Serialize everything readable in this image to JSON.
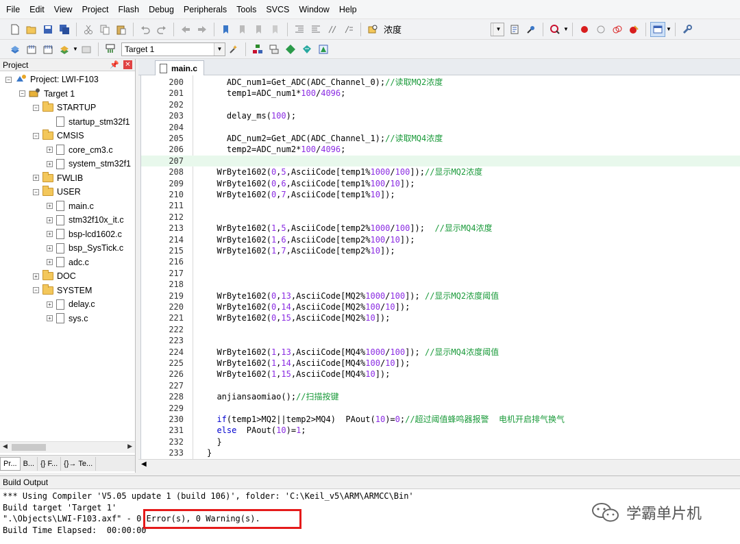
{
  "menu": [
    "File",
    "Edit",
    "View",
    "Project",
    "Flash",
    "Debug",
    "Peripherals",
    "Tools",
    "SVCS",
    "Window",
    "Help"
  ],
  "toolbar": {
    "find_text": "浓度",
    "target_select": "Target 1"
  },
  "project_panel": {
    "title": "Project",
    "pin": "ᵽ",
    "tree": [
      {
        "label": "Project: LWI-F103",
        "level": 0,
        "kind": "project"
      },
      {
        "label": "Target 1",
        "level": 1,
        "kind": "target"
      },
      {
        "label": "STARTUP",
        "level": 2,
        "kind": "folder"
      },
      {
        "label": "startup_stm32f1",
        "level": 3,
        "kind": "file"
      },
      {
        "label": "CMSIS",
        "level": 2,
        "kind": "folder"
      },
      {
        "label": "core_cm3.c",
        "level": 3,
        "kind": "file"
      },
      {
        "label": "system_stm32f1",
        "level": 3,
        "kind": "file"
      },
      {
        "label": "FWLIB",
        "level": 2,
        "kind": "folder"
      },
      {
        "label": "USER",
        "level": 2,
        "kind": "folder"
      },
      {
        "label": "main.c",
        "level": 3,
        "kind": "file"
      },
      {
        "label": "stm32f10x_it.c",
        "level": 3,
        "kind": "file"
      },
      {
        "label": "bsp-lcd1602.c",
        "level": 3,
        "kind": "file"
      },
      {
        "label": "bsp_SysTick.c",
        "level": 3,
        "kind": "file"
      },
      {
        "label": "adc.c",
        "level": 3,
        "kind": "file"
      },
      {
        "label": "DOC",
        "level": 2,
        "kind": "folder"
      },
      {
        "label": "SYSTEM",
        "level": 2,
        "kind": "folder"
      },
      {
        "label": "delay.c",
        "level": 3,
        "kind": "file"
      },
      {
        "label": "sys.c",
        "level": 3,
        "kind": "file"
      }
    ],
    "tabs": [
      "Pr...",
      "B...",
      "{} F...",
      "{}→ Te..."
    ]
  },
  "editor": {
    "tab": "main.c",
    "lines": [
      {
        "n": "200",
        "code": "    ADC_num1=Get_ADC(ADC_Channel_0);",
        "comment": "//读取MQ2浓度"
      },
      {
        "n": "201",
        "code": "    temp1=ADC_num1*100/4096;",
        "comment": ""
      },
      {
        "n": "202",
        "code": "",
        "comment": ""
      },
      {
        "n": "203",
        "code": "    delay_ms(100);",
        "comment": ""
      },
      {
        "n": "204",
        "code": "",
        "comment": ""
      },
      {
        "n": "205",
        "code": "    ADC_num2=Get_ADC(ADC_Channel_1);",
        "comment": "//读取MQ4浓度"
      },
      {
        "n": "206",
        "code": "    temp2=ADC_num2*100/4096;",
        "comment": ""
      },
      {
        "n": "207",
        "code": "",
        "comment": "",
        "hl": true
      },
      {
        "n": "208",
        "code": "  WrByte1602(0,5,AsciiCode[temp1%1000/100]);",
        "comment": "//显示MQ2浓度"
      },
      {
        "n": "209",
        "code": "  WrByte1602(0,6,AsciiCode[temp1%100/10]);",
        "comment": ""
      },
      {
        "n": "210",
        "code": "  WrByte1602(0,7,AsciiCode[temp1%10]);",
        "comment": ""
      },
      {
        "n": "211",
        "code": "",
        "comment": ""
      },
      {
        "n": "212",
        "code": "",
        "comment": ""
      },
      {
        "n": "213",
        "code": "  WrByte1602(1,5,AsciiCode[temp2%1000/100]);  ",
        "comment": "//显示MQ4浓度"
      },
      {
        "n": "214",
        "code": "  WrByte1602(1,6,AsciiCode[temp2%100/10]);",
        "comment": ""
      },
      {
        "n": "215",
        "code": "  WrByte1602(1,7,AsciiCode[temp2%10]);",
        "comment": ""
      },
      {
        "n": "216",
        "code": "",
        "comment": ""
      },
      {
        "n": "217",
        "code": "",
        "comment": ""
      },
      {
        "n": "218",
        "code": "",
        "comment": ""
      },
      {
        "n": "219",
        "code": "  WrByte1602(0,13,AsciiCode[MQ2%1000/100]); ",
        "comment": "//显示MQ2浓度阈值"
      },
      {
        "n": "220",
        "code": "  WrByte1602(0,14,AsciiCode[MQ2%100/10]);",
        "comment": ""
      },
      {
        "n": "221",
        "code": "  WrByte1602(0,15,AsciiCode[MQ2%10]);",
        "comment": ""
      },
      {
        "n": "222",
        "code": "",
        "comment": ""
      },
      {
        "n": "223",
        "code": "",
        "comment": ""
      },
      {
        "n": "224",
        "code": "  WrByte1602(1,13,AsciiCode[MQ4%1000/100]); ",
        "comment": "//显示MQ4浓度阈值"
      },
      {
        "n": "225",
        "code": "  WrByte1602(1,14,AsciiCode[MQ4%100/10]);",
        "comment": ""
      },
      {
        "n": "226",
        "code": "  WrByte1602(1,15,AsciiCode[MQ4%10]);",
        "comment": ""
      },
      {
        "n": "227",
        "code": "",
        "comment": ""
      },
      {
        "n": "228",
        "code": "  anjiansaomiao();",
        "comment": "//扫描按键"
      },
      {
        "n": "229",
        "code": "",
        "comment": ""
      },
      {
        "n": "230",
        "code": "  if(temp1>MQ2||temp2>MQ4)  PAout(10)=0;",
        "comment": "//超过阈值蜂鸣器报警  电机开启排气换气"
      },
      {
        "n": "231",
        "code": "  else  PAout(10)=1;",
        "comment": ""
      },
      {
        "n": "232",
        "code": "  }",
        "comment": ""
      },
      {
        "n": "233",
        "code": "}",
        "comment": ""
      }
    ]
  },
  "build_output": {
    "title": "Build Output",
    "lines": [
      "*** Using Compiler 'V5.05 update 1 (build 106)', folder: 'C:\\Keil_v5\\ARM\\ARMCC\\Bin'",
      "Build target 'Target 1'",
      "\".\\Objects\\LWI-F103.axf\" - 0 Error(s), 0 Warning(s).",
      "Build Time Elapsed:  00:00:00"
    ]
  },
  "watermark": "学霸单片机",
  "colors": {
    "comment": "#1a9a3a",
    "number": "#8a2be2",
    "keyword": "#0000d0",
    "highlight_box": "#e51a1a"
  }
}
